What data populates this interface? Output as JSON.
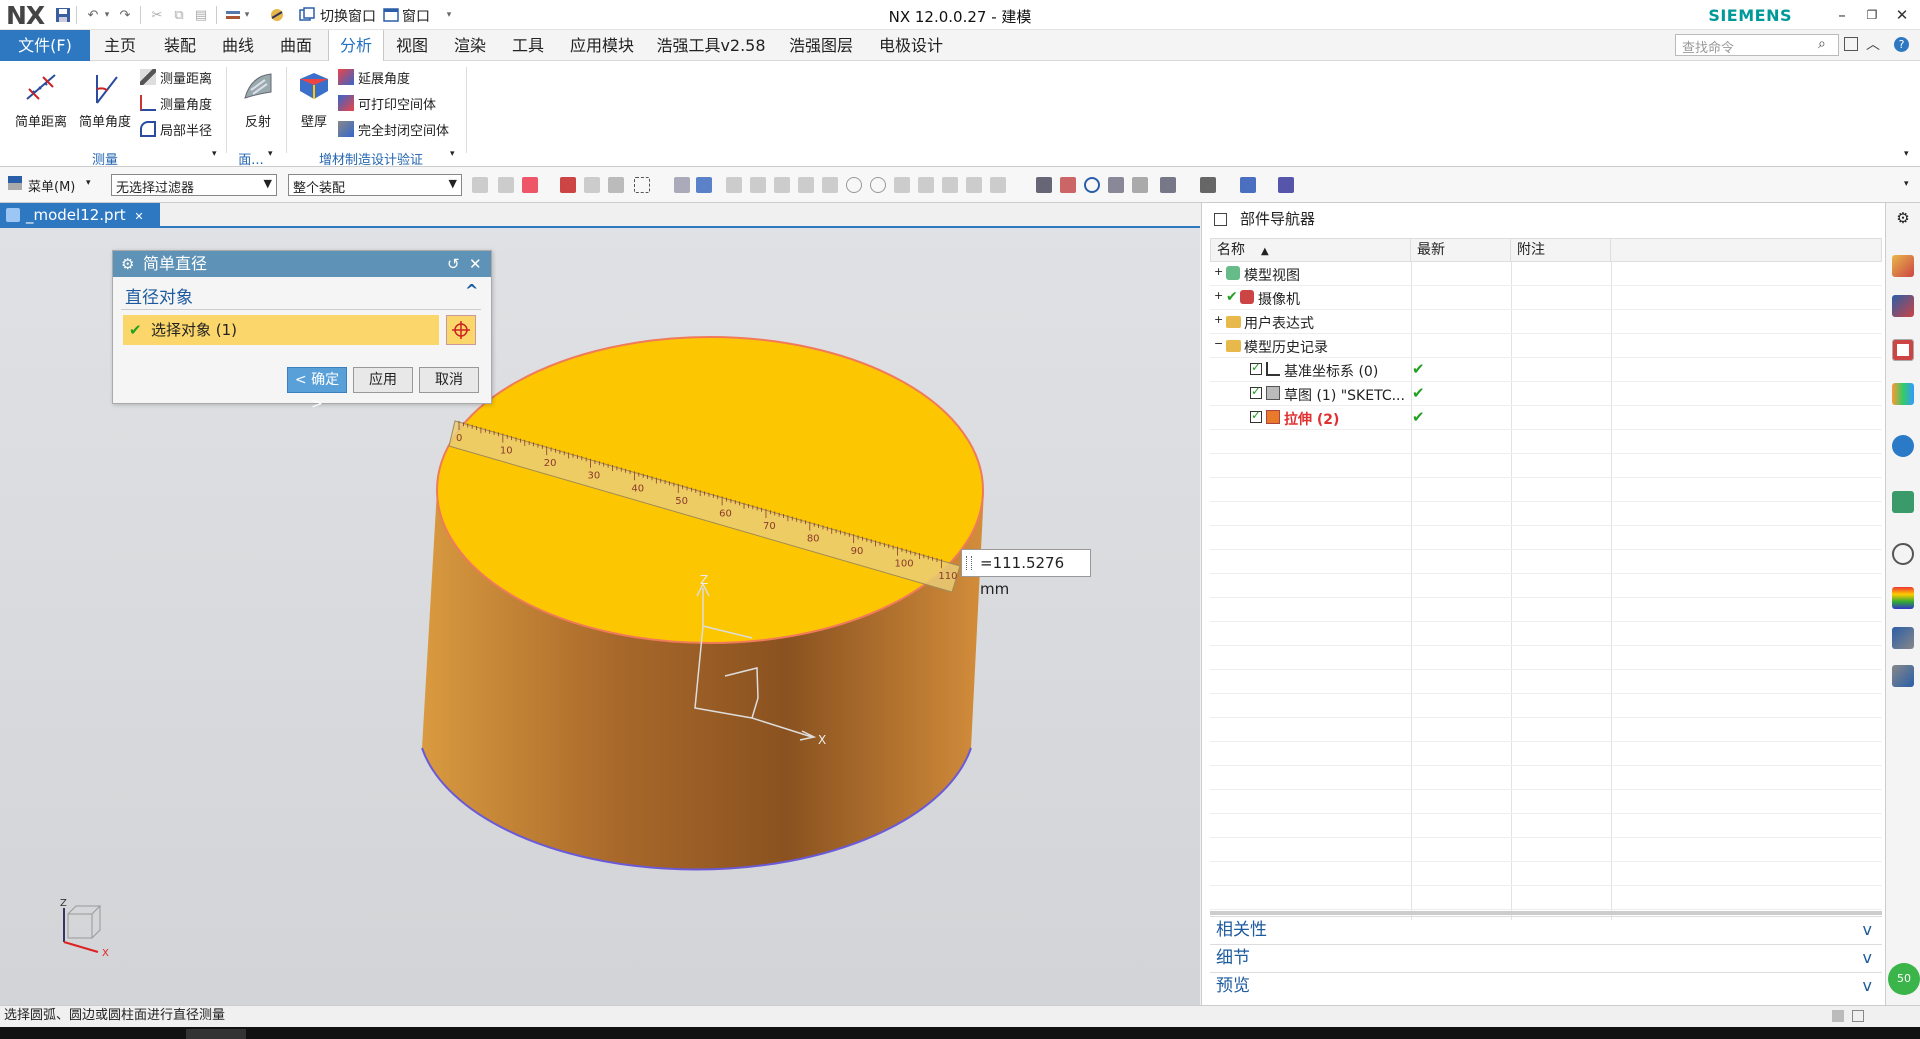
{
  "titlebar": {
    "logo": "NX",
    "switch_window": "切换窗口",
    "window_menu": "窗口",
    "title": "NX 12.0.0.27 - 建模",
    "brand": "SIEMENS"
  },
  "menubar": {
    "file": "文件(F)",
    "tabs": [
      "主页",
      "装配",
      "曲线",
      "曲面",
      "分析",
      "视图",
      "渲染",
      "工具",
      "应用模块",
      "浩强工具v2.58",
      "浩强图层",
      "电极设计"
    ],
    "search_placeholder": "查找命令"
  },
  "ribbon": {
    "simple_distance": "简单距离",
    "simple_angle": "简单角度",
    "measure_distance": "测量距离",
    "measure_angle": "测量角度",
    "local_radius": "局部半径",
    "group_measure": "测量",
    "reflect": "反射",
    "group_face": "面...",
    "wall_thickness": "壁厚",
    "extend_angle": "延展角度",
    "printable_volume": "可打印空间体",
    "enclosed_volume": "完全封闭空间体",
    "group_additive": "增材制造设计验证"
  },
  "toolbar": {
    "menu": "菜单(M)",
    "filter": "无选择过滤器",
    "scope": "整个装配"
  },
  "doc_tab": {
    "name": "_model12.prt"
  },
  "dialog": {
    "title": "简单直径",
    "section": "直径对象",
    "select_row": "选择对象 (1)",
    "ok": "< 确定 >",
    "apply": "应用",
    "cancel": "取消"
  },
  "viewport": {
    "measurement": "=111.5276 mm",
    "ruler_ticks": [
      "0",
      "10",
      "20",
      "30",
      "40",
      "50",
      "60",
      "70",
      "80",
      "90",
      "100",
      "110"
    ],
    "axis_x": "X",
    "axis_z": "Z",
    "triad_x": "X",
    "triad_z": "Z"
  },
  "navigator": {
    "title": "部件导航器",
    "columns": [
      "名称",
      "最新",
      "附注"
    ],
    "rows": [
      {
        "label": "模型视图",
        "latest": ""
      },
      {
        "label": "摄像机",
        "latest": ""
      },
      {
        "label": "用户表达式",
        "latest": ""
      },
      {
        "label": "模型历史记录",
        "latest": ""
      },
      {
        "label": "基准坐标系 (0)",
        "latest": "✔"
      },
      {
        "label": "草图 (1) \"SKETC...",
        "latest": "✔"
      },
      {
        "label": "拉伸 (2)",
        "latest": "✔"
      }
    ],
    "panels": [
      "相关性",
      "细节",
      "预览"
    ]
  },
  "status": {
    "text": "选择圆弧、圆边或圆柱面进行直径测量"
  },
  "colors": {
    "accent": "#2e78c1",
    "highlight": "#fbc600",
    "body": "#c98a35",
    "check": "#22a022"
  }
}
